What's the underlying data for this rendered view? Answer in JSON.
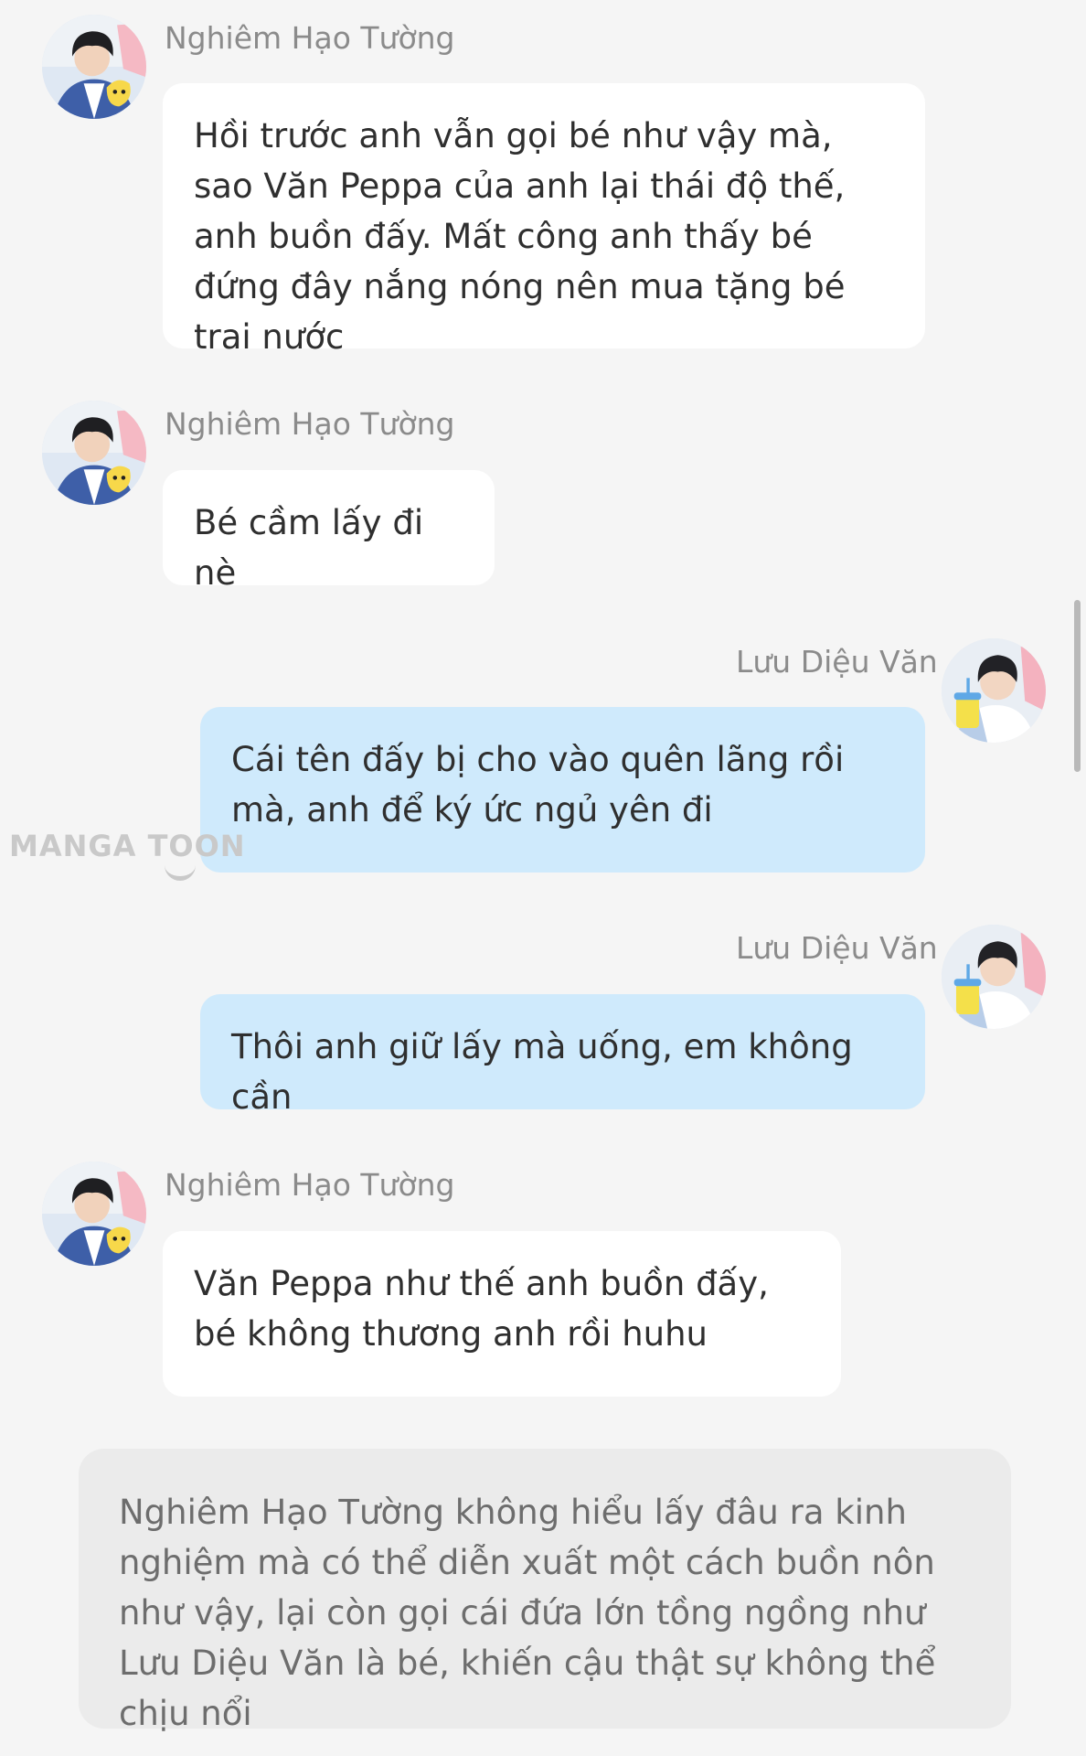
{
  "messages": [
    {
      "sender": "Nghiêm Hạo Tường",
      "side": "left",
      "text": "Hồi trước anh vẫn gọi bé như vậy mà, sao Văn Peppa của anh lại thái độ thế, anh buồn đấy. Mất công anh thấy bé đứng đây nắng nóng nên mua tặng bé trai nước"
    },
    {
      "sender": "Nghiêm Hạo Tường",
      "side": "left",
      "text": "Bé cầm lấy đi nè"
    },
    {
      "sender": "Lưu Diệu Văn",
      "side": "right",
      "text": "Cái tên đấy bị cho vào quên lãng rồi mà, anh để ký ức ngủ yên đi"
    },
    {
      "sender": "Lưu Diệu Văn",
      "side": "right",
      "text": "Thôi anh giữ lấy mà uống, em không cần"
    },
    {
      "sender": "Nghiêm Hạo Tường",
      "side": "left",
      "text": "Văn Peppa như thế anh buồn đấy, bé không thương anh rồi huhu"
    }
  ],
  "narration": "Nghiêm Hạo Tường không hiểu lấy đâu ra kinh nghiệm mà có thể diễn xuất một cách buồn nôn như vậy, lại còn gọi cái đứa lớn tồng ngồng như Lưu Diệu Văn là bé, khiến cậu thật sự không thể chịu nổi",
  "watermark": "MANGA TOON",
  "colors": {
    "background": "#f5f5f5",
    "left_bubble": "#ffffff",
    "right_bubble": "#cfeafc",
    "narration_bg": "#ebebeb",
    "sender_name": "#8b8b8b"
  },
  "icons": {
    "avatar_left": "avatar-nghiem-hao-tuong",
    "avatar_right": "avatar-luu-dieu-van"
  }
}
